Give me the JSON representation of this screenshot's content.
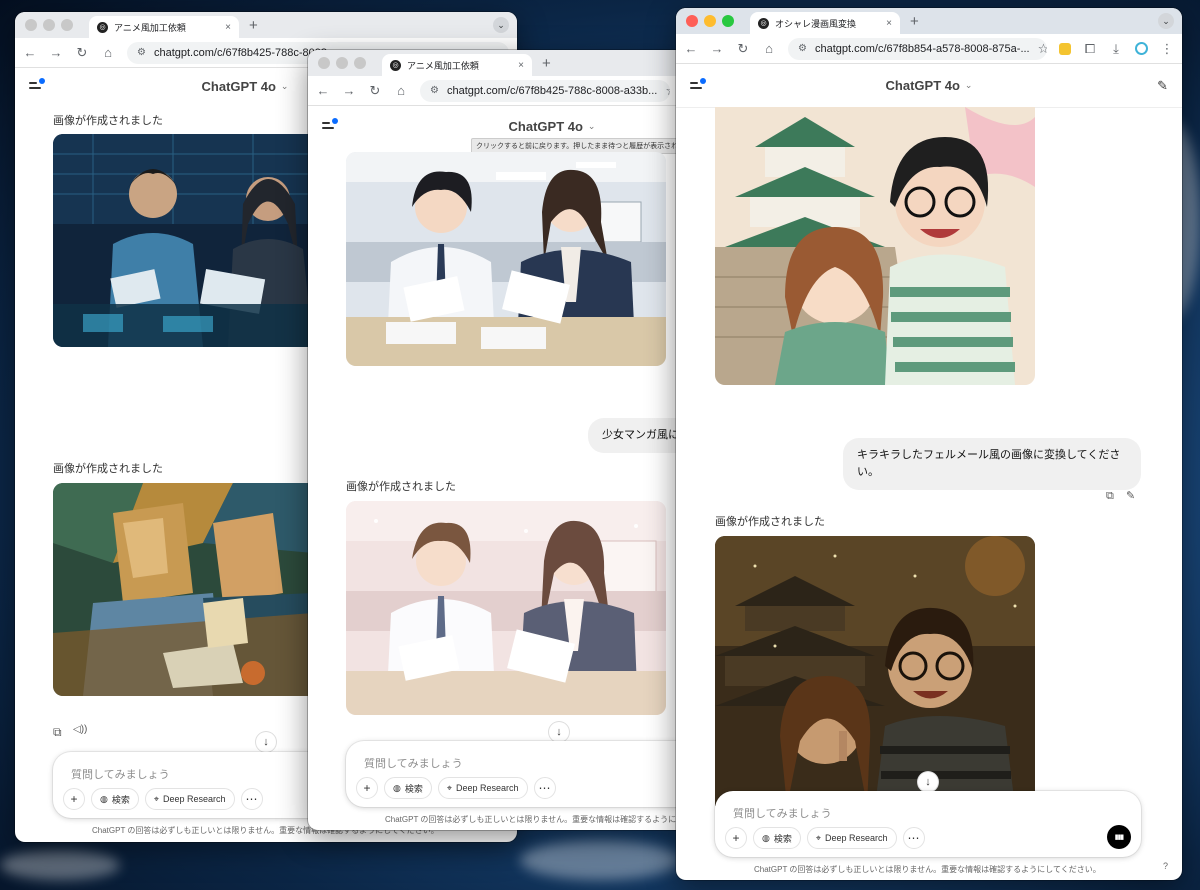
{
  "window1": {
    "tab_title": "アニメ風加工依頼",
    "url": "chatgpt.com/c/67f8b425-788c-8008",
    "model": "ChatGPT 4o",
    "notes": [
      "画像が作成されました",
      "画像が作成されました"
    ],
    "composer_placeholder": "質問してみましょう",
    "tools": {
      "search": "検索",
      "deep_research": "Deep Research"
    },
    "disclaimer": "ChatGPT の回答は必ずしも正しいとは限りません。重要な情報は確認するようにしてください。"
  },
  "window2": {
    "tab_title": "アニメ風加工依頼",
    "url": "chatgpt.com/c/67f8b425-788c-8008-a33b...",
    "model": "ChatGPT 4o",
    "tooltip": "クリックすると前に戻ります。押したまま待つと履歴が表示されます。",
    "user_message": "少女マンガ風に",
    "note": "画像が作成されました",
    "composer_placeholder": "質問してみましょう",
    "tools": {
      "search": "検索",
      "deep_research": "Deep Research"
    },
    "disclaimer": "ChatGPT の回答は必ずしも正しいとは限りません。重要な情報は確認するように"
  },
  "window3": {
    "tab_title": "オシャレ漫画風変換",
    "url": "chatgpt.com/c/67f8b854-a578-8008-875a-...",
    "model": "ChatGPT 4o",
    "user_message": "キラキラしたフェルメール風の画像に変換してください。",
    "note": "画像が作成されました",
    "composer_placeholder": "質問してみましょう",
    "tools": {
      "search": "検索",
      "deep_research": "Deep Research"
    },
    "disclaimer": "ChatGPT の回答は必ずしも正しいとは限りません。重要な情報は確認するようにしてください。",
    "help": "?"
  },
  "icons": {
    "back": "←",
    "forward": "→",
    "reload": "↻",
    "home": "⌂",
    "star": "☆",
    "plus": "+",
    "close": "×",
    "more": "⋯",
    "down": "↓",
    "chevron": "⌄",
    "copy": "⧉",
    "edit": "✎",
    "speaker": "🔈",
    "globe": "◍",
    "telescope": "⌖",
    "voice": "▮▮▮"
  }
}
